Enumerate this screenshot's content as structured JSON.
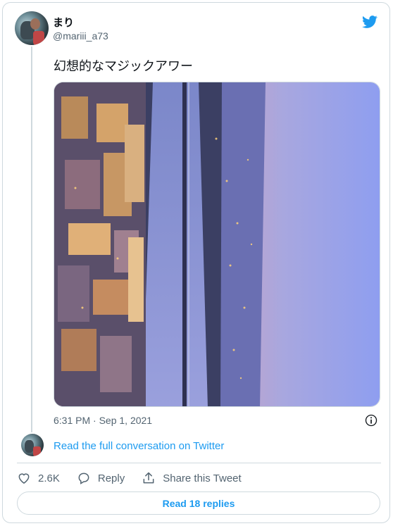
{
  "author": {
    "display_name": "まり",
    "handle": "@mariii_a73"
  },
  "tweet": {
    "text": "幻想的なマジックアワー",
    "photo_icon": "photo-twilight-cityscape",
    "timestamp": "6:31 PM · Sep 1, 2021"
  },
  "conversation": {
    "link_text": "Read the full conversation on Twitter"
  },
  "actions": {
    "likes_count": "2.6K",
    "reply_label": "Reply",
    "share_label": "Share this Tweet"
  },
  "replies_button": "Read 18 replies",
  "colors": {
    "twitter_blue": "#1d9bf0",
    "text_primary": "#0f1419",
    "text_secondary": "#536471",
    "border": "#cfd9de"
  }
}
